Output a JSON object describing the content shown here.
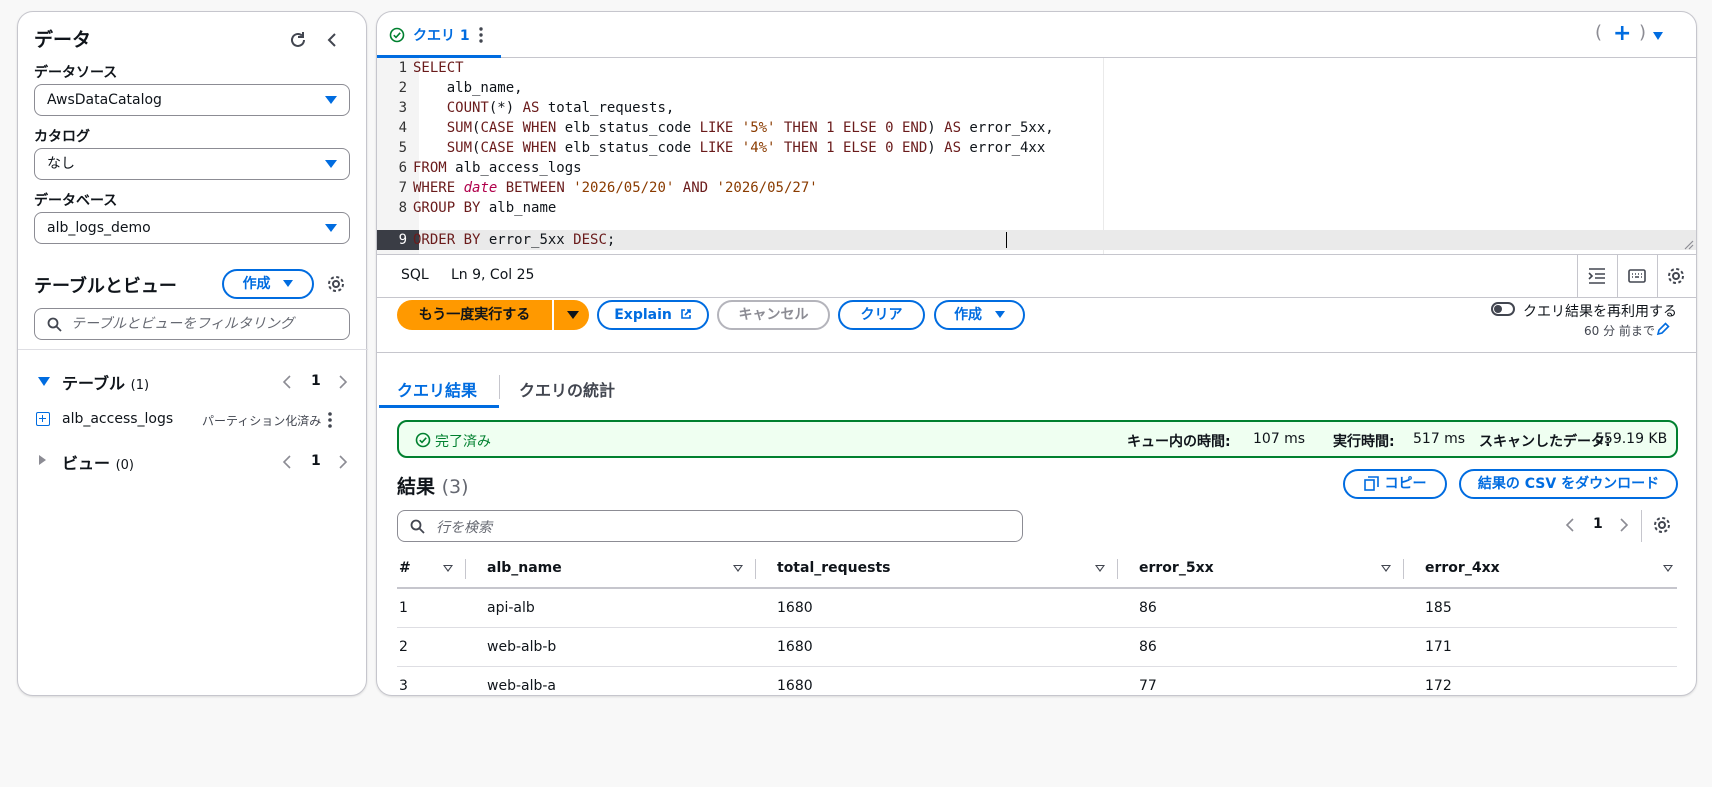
{
  "left": {
    "title": "データ",
    "datasource": {
      "label": "データソース",
      "value": "AwsDataCatalog"
    },
    "catalog": {
      "label": "カタログ",
      "value": "なし"
    },
    "database": {
      "label": "データベース",
      "value": "alb_logs_demo"
    },
    "tables_views": {
      "title": "テーブルとビュー",
      "create_label": "作成",
      "filter_placeholder": "テーブルとビューをフィルタリング"
    },
    "tables": {
      "label": "テーブル",
      "count": "(1)",
      "page": "1",
      "items": [
        {
          "name": "alb_access_logs",
          "badge": "パーティション化済み"
        }
      ]
    },
    "views": {
      "label": "ビュー",
      "count": "(0)",
      "page": "1"
    }
  },
  "editor": {
    "tab_label": "クエリ 1",
    "lines": [
      "1",
      "2",
      "3",
      "4",
      "5",
      "6",
      "7",
      "8",
      "9"
    ],
    "status_lang": "SQL",
    "status_pos": "Ln 9, Col 25"
  },
  "toolbar": {
    "run_label": "もう一度実行する",
    "explain_label": "Explain",
    "cancel_label": "キャンセル",
    "clear_label": "クリア",
    "create_label": "作成",
    "reuse_label": "クエリ結果を再利用する",
    "reuse_sub": "60 分 前まで"
  },
  "results_tabs": {
    "results": "クエリ結果",
    "stats": "クエリの統計"
  },
  "status": {
    "text": "完了済み",
    "queue_label": "キュー内の時間:",
    "queue_value": "107 ms",
    "exec_label": "実行時間:",
    "exec_value": "517 ms",
    "scan_label": "スキャンしたデータ:",
    "scan_value": "559.19 KB"
  },
  "results": {
    "title": "結果",
    "count": "(3)",
    "copy_label": "コピー",
    "download_label": "結果の CSV をダウンロード",
    "search_placeholder": "行を検索",
    "page": "1",
    "columns": [
      "#",
      "alb_name",
      "total_requests",
      "error_5xx",
      "error_4xx"
    ],
    "rows": [
      [
        "1",
        "api-alb",
        "1680",
        "86",
        "185"
      ],
      [
        "2",
        "web-alb-b",
        "1680",
        "86",
        "171"
      ],
      [
        "3",
        "web-alb-a",
        "1680",
        "77",
        "172"
      ]
    ]
  }
}
